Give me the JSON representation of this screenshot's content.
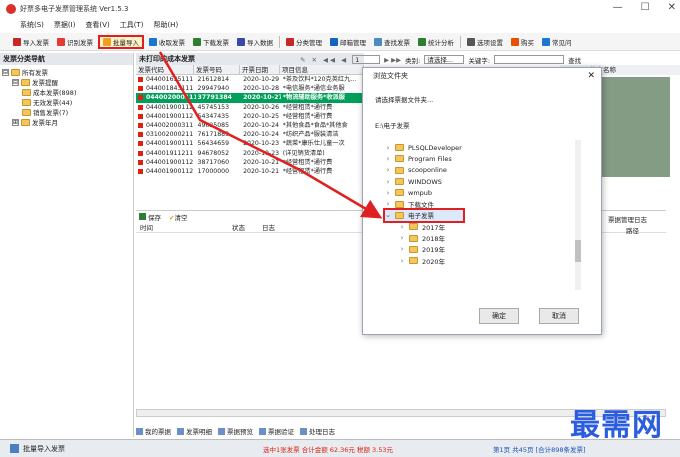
{
  "window": {
    "title": "好票多电子发票管理系统 Ver1.5.3",
    "controls": [
      "—",
      "☐",
      "✕"
    ]
  },
  "menu": [
    "系统(S)",
    "票据(I)",
    "查看(V)",
    "工具(T)",
    "帮助(H)"
  ],
  "toolbar": [
    {
      "label": "导入发票",
      "color": "#c62828"
    },
    {
      "label": "识别发票",
      "color": "#e53935"
    },
    {
      "label": "批量导入",
      "color": "#f0a020",
      "active": true
    },
    {
      "label": "收取发票",
      "color": "#1976d2"
    },
    {
      "label": "下载发票",
      "color": "#2e7d32"
    },
    {
      "label": "导入数据",
      "color": "#3949ab"
    },
    {
      "label": "分类管理",
      "color": "#c62828"
    },
    {
      "label": "邮箱管理",
      "color": "#1565c0"
    },
    {
      "label": "查找发票",
      "color": "#4e89c7"
    },
    {
      "label": "统计分析",
      "color": "#2e7d32"
    },
    {
      "label": "选项设置",
      "color": "#555555"
    },
    {
      "label": "购买",
      "color": "#e65100"
    },
    {
      "label": "常见问",
      "color": "#1976d2"
    }
  ],
  "left_panel": {
    "header": "发票分类导航",
    "tree": [
      {
        "label": "所有发票",
        "level": 0,
        "toggle": "⊟"
      },
      {
        "label": "发票提醒",
        "level": 1,
        "toggle": "⊟"
      },
      {
        "label": "成本发票(898)",
        "level": 2
      },
      {
        "label": "无效发票(44)",
        "level": 2
      },
      {
        "label": "销售发票(7)",
        "level": 2
      },
      {
        "label": "发票年月",
        "level": 1,
        "toggle": "⊞"
      }
    ]
  },
  "grid": {
    "header": "未打印的成本发票",
    "columns": [
      "发票代码",
      "发票号码",
      "开票日期",
      "项目信息"
    ],
    "rows": [
      [
        "044001635111",
        "21612814",
        "2020-10-29",
        "*茶及饮料*120克英红九..."
      ],
      [
        "044001843111",
        "29947940",
        "2020-10-28",
        "*电信服务*通信业务服"
      ],
      [
        "044002000111",
        "37791384",
        "2020-10-27",
        "*物流辅助服务*收派服",
        "sel"
      ],
      [
        "044001900112",
        "45745153",
        "2020-10-26",
        "*经营租赁*通行费"
      ],
      [
        "044001900112",
        "54347435",
        "2020-10-25",
        "*经营租赁*通行费"
      ],
      [
        "044002000311",
        "49625085",
        "2020-10-24",
        "*其他食品*食品*其他食"
      ],
      [
        "031002000211",
        "76171883",
        "2020-10-24",
        "*纺织产品*服装清洁"
      ],
      [
        "044001900111",
        "56434659",
        "2020-10-23",
        "*蔬菜*康乐仕儿童一次"
      ],
      [
        "044001911211",
        "94678052",
        "2020-10-23",
        "(详见销货清单)"
      ],
      [
        "044001900112",
        "38717060",
        "2020-10-21",
        "*经营租赁*通行费"
      ],
      [
        "044001900112",
        "17000000",
        "2020-10-21",
        "*经营租赁*通行费"
      ]
    ],
    "search_type_label": "类别:",
    "search_type_value": "请选择...",
    "keyword_label": "关键字:",
    "find_label": "查找",
    "page_value": "1"
  },
  "right_grid": {
    "header": "售方名称",
    "log_header": "票据管理日志",
    "path_col": "路径"
  },
  "log": {
    "save": "保存",
    "clear": "清空",
    "columns": [
      "时间",
      "状态",
      "日志"
    ]
  },
  "bottom_tabs": [
    "我的票据",
    "发票明细",
    "票据预览",
    "票据验证",
    "处理日志"
  ],
  "status": {
    "left": "批量导入发票",
    "middle": "选中1张发票 合计金额 62.36元 税额 3.53元",
    "right": "第1页 共45页 [合计898条发票]"
  },
  "dialog": {
    "title": "浏览文件夹",
    "prompt": "请选择票据文件夹...",
    "path": "E:\\电子发票",
    "items": [
      {
        "label": "PLSQLDeveloper",
        "level": 0,
        "arrow": "›"
      },
      {
        "label": "Program Files",
        "level": 0,
        "arrow": "›"
      },
      {
        "label": "scooponline",
        "level": 0,
        "arrow": "›"
      },
      {
        "label": "WINDOWS",
        "level": 0,
        "arrow": "›"
      },
      {
        "label": "wmpub",
        "level": 0,
        "arrow": "›"
      },
      {
        "label": "下载文件",
        "level": 0,
        "arrow": "›"
      },
      {
        "label": "电子发票",
        "level": 0,
        "arrow": "⌄",
        "selected": true
      },
      {
        "label": "2017年",
        "level": 1,
        "arrow": "›"
      },
      {
        "label": "2018年",
        "level": 1,
        "arrow": "›"
      },
      {
        "label": "2019年",
        "level": 1,
        "arrow": "›"
      },
      {
        "label": "2020年",
        "level": 1,
        "arrow": "›"
      }
    ],
    "ok": "确定",
    "cancel": "取消"
  },
  "watermark": "最需网"
}
